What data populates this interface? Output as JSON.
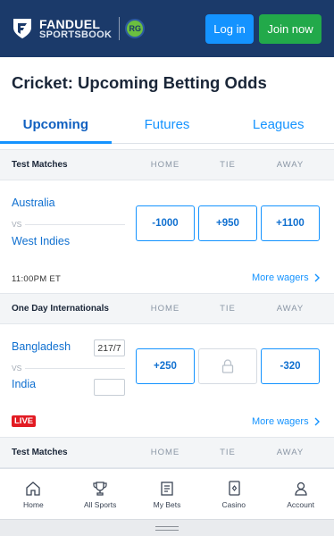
{
  "header": {
    "logo_line1": "FANDUEL",
    "logo_line2": "SPORTSBOOK",
    "rg_badge": "RG",
    "login_label": "Log in",
    "join_label": "Join now",
    "brand_color": "#1b3a6a",
    "login_color": "#1493ff",
    "join_color": "#22a94a"
  },
  "page": {
    "title": "Cricket: Upcoming Betting Odds"
  },
  "tabs": [
    {
      "label": "Upcoming",
      "active": true
    },
    {
      "label": "Futures",
      "active": false
    },
    {
      "label": "Leagues",
      "active": false
    }
  ],
  "columns": {
    "home": "HOME",
    "tie": "TIE",
    "away": "AWAY"
  },
  "sections": [
    {
      "title": "Test Matches",
      "match": {
        "team1": "Australia",
        "vs": "VS",
        "team2": "West Indies",
        "odds_home": "-1000",
        "odds_tie": "+950",
        "odds_away": "+1100",
        "time": "11:00PM ET",
        "more": "More wagers"
      }
    },
    {
      "title": "One Day Internationals",
      "match": {
        "team1": "Bangladesh",
        "team1_score": "217/7",
        "vs": "VS",
        "team2": "India",
        "team2_score": "",
        "odds_home": "+250",
        "odds_tie_icon": "lock-icon",
        "odds_away": "-320",
        "live": "LIVE",
        "more": "More wagers"
      }
    },
    {
      "title": "Test Matches"
    }
  ],
  "bottom_nav": [
    {
      "label": "Home",
      "icon": "home-icon"
    },
    {
      "label": "All Sports",
      "icon": "trophy-icon"
    },
    {
      "label": "My Bets",
      "icon": "bet-slip-icon"
    },
    {
      "label": "Casino",
      "icon": "casino-card-icon"
    },
    {
      "label": "Account",
      "icon": "account-icon"
    }
  ]
}
